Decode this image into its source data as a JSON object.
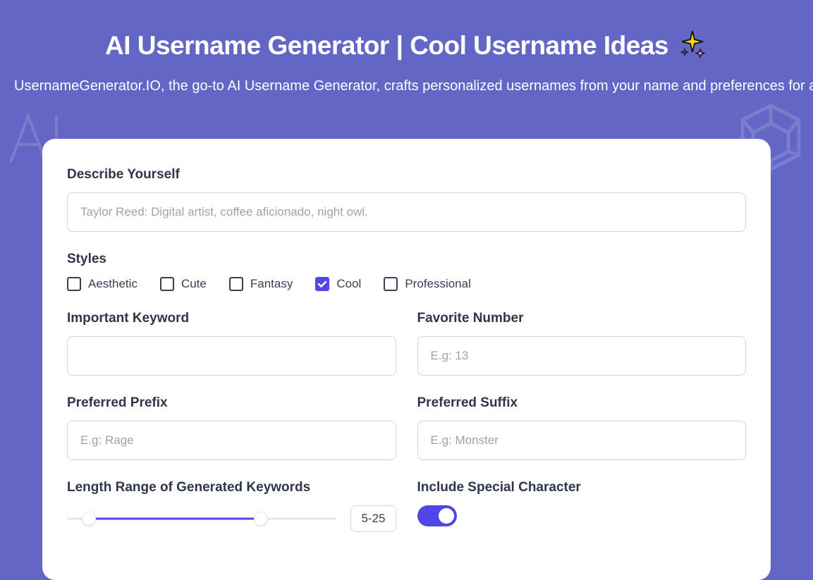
{
  "header": {
    "title": "AI Username Generator | Cool Username Ideas",
    "subtitle": "UsernameGenerator.IO, the go-to AI Username Generator, crafts personalized usernames from your name and preferences for aesthetic, cute, cool, and fantasy username ideas for all platforms!"
  },
  "form": {
    "describe": {
      "label": "Describe Yourself",
      "placeholder": "Taylor Reed: Digital artist, coffee aficionado, night owl.",
      "value": ""
    },
    "styles": {
      "label": "Styles",
      "options": [
        {
          "label": "Aesthetic",
          "checked": false
        },
        {
          "label": "Cute",
          "checked": false
        },
        {
          "label": "Fantasy",
          "checked": false
        },
        {
          "label": "Cool",
          "checked": true
        },
        {
          "label": "Professional",
          "checked": false
        }
      ]
    },
    "keyword": {
      "label": "Important Keyword",
      "placeholder": "",
      "value": ""
    },
    "number": {
      "label": "Favorite Number",
      "placeholder": "E.g: 13",
      "value": ""
    },
    "prefix": {
      "label": "Preferred Prefix",
      "placeholder": "E.g: Rage",
      "value": ""
    },
    "suffix": {
      "label": "Preferred Suffix",
      "placeholder": "E.g: Monster",
      "value": ""
    },
    "range": {
      "label": "Length Range of Generated Keywords",
      "display": "5-25"
    },
    "special": {
      "label": "Include Special Character",
      "enabled": true
    }
  }
}
